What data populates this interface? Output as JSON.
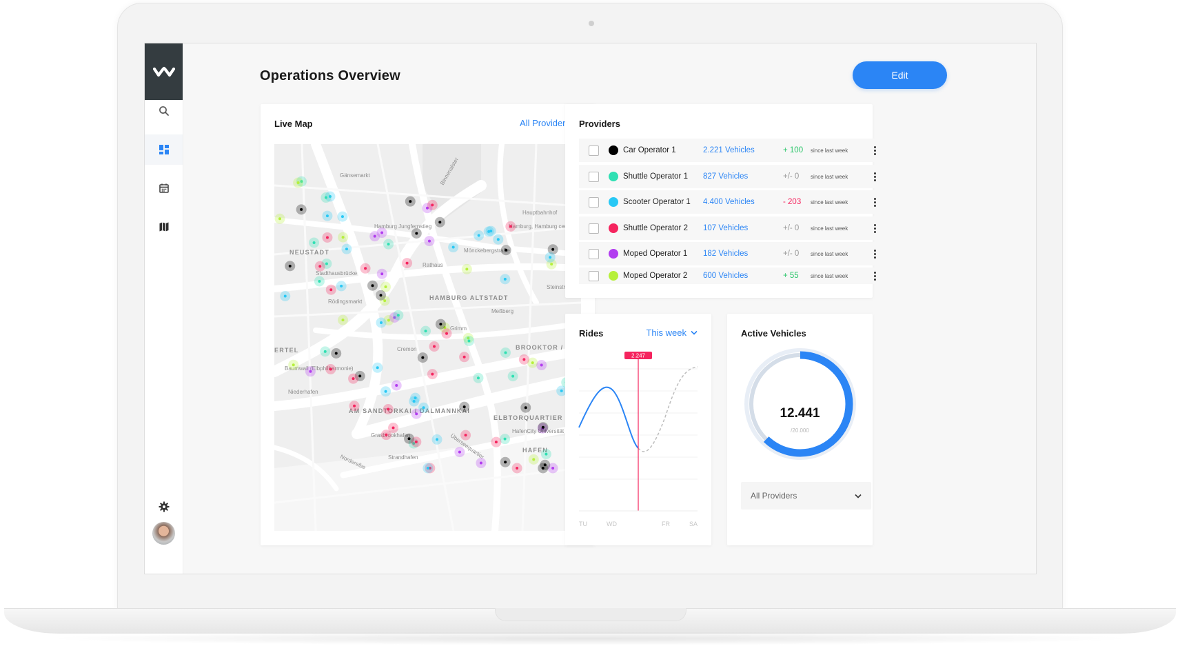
{
  "page": {
    "title": "Operations Overview",
    "edit_label": "Edit"
  },
  "sidebar": {
    "items": [
      {
        "icon": "search-icon"
      },
      {
        "icon": "dashboard-icon",
        "active": true
      },
      {
        "icon": "calendar-icon"
      },
      {
        "icon": "map-icon"
      }
    ],
    "bottom": [
      {
        "icon": "gear-icon"
      },
      {
        "icon": "avatar"
      }
    ]
  },
  "live_map": {
    "title": "Live Map",
    "filter_label": "All Providers",
    "labels": [
      "Gänsemarkt",
      "NEUSTADT",
      "Hamburg Jungfernstieg",
      "Stadthausbrücke",
      "Rathaus",
      "Mönckebergstraße",
      "Hamburg, Hamburg central station (train)",
      "Hauptbahnhof",
      "Steinstraße",
      "HAMBURG ALTSTADT",
      "Meßberg",
      "Rödingsmarkt",
      "Grimm",
      "Cremon",
      "BROOKTOR / ERICUS",
      "ERTEL",
      "Baumwall (Elbphilharmonie)",
      "Niederhafen",
      "AM SANDTORKAI / DALMANNKAI",
      "ELBTORQUARTIER",
      "HafenCity Universität",
      "Überseequartier",
      "Grasbrookhafen",
      "Strandhafen",
      "HAFEN",
      "Norderelbe",
      "Binnenalster"
    ]
  },
  "providers": {
    "title": "Providers",
    "rows": [
      {
        "name": "Car Operator 1",
        "vehicles": "2.221 Vehicles",
        "delta": "+ 100",
        "delta_type": "up",
        "since": "since last week",
        "color": "#000000"
      },
      {
        "name": "Shuttle Operator 1",
        "vehicles": "827 Vehicles",
        "delta": "+/- 0",
        "delta_type": "flat",
        "since": "since last week",
        "color": "#2fe0b3"
      },
      {
        "name": "Scooter Operator 1",
        "vehicles": "4.400 Vehicles",
        "delta": "- 203",
        "delta_type": "down",
        "since": "since last week",
        "color": "#28c8f5"
      },
      {
        "name": "Shuttle Operator 2",
        "vehicles": "107 Vehicles",
        "delta": "+/- 0",
        "delta_type": "flat",
        "since": "since last week",
        "color": "#f5245e"
      },
      {
        "name": "Moped Operator 1",
        "vehicles": "182 Vehicles",
        "delta": "+/- 0",
        "delta_type": "flat",
        "since": "since last week",
        "color": "#b23cf0"
      },
      {
        "name": "Moped Operator 2",
        "vehicles": "600 Vehicles",
        "delta": "+ 55",
        "delta_type": "up",
        "since": "since last week",
        "color": "#b6f03a"
      }
    ],
    "colors": {
      "up": "#2bc66a",
      "down": "#f5245e",
      "flat": "#999999"
    }
  },
  "rides": {
    "title": "Rides",
    "filter_label": "This week",
    "marker_value": "2.247",
    "days": [
      "TU",
      "WD",
      "FR",
      "SA"
    ]
  },
  "active_vehicles": {
    "title": "Active Vehicles",
    "value": "12.441",
    "total": "/20.000",
    "fraction": 0.622,
    "select_label": "All Providers"
  },
  "colors": {
    "accent": "#2b85f5",
    "marker": "#f5245e"
  }
}
